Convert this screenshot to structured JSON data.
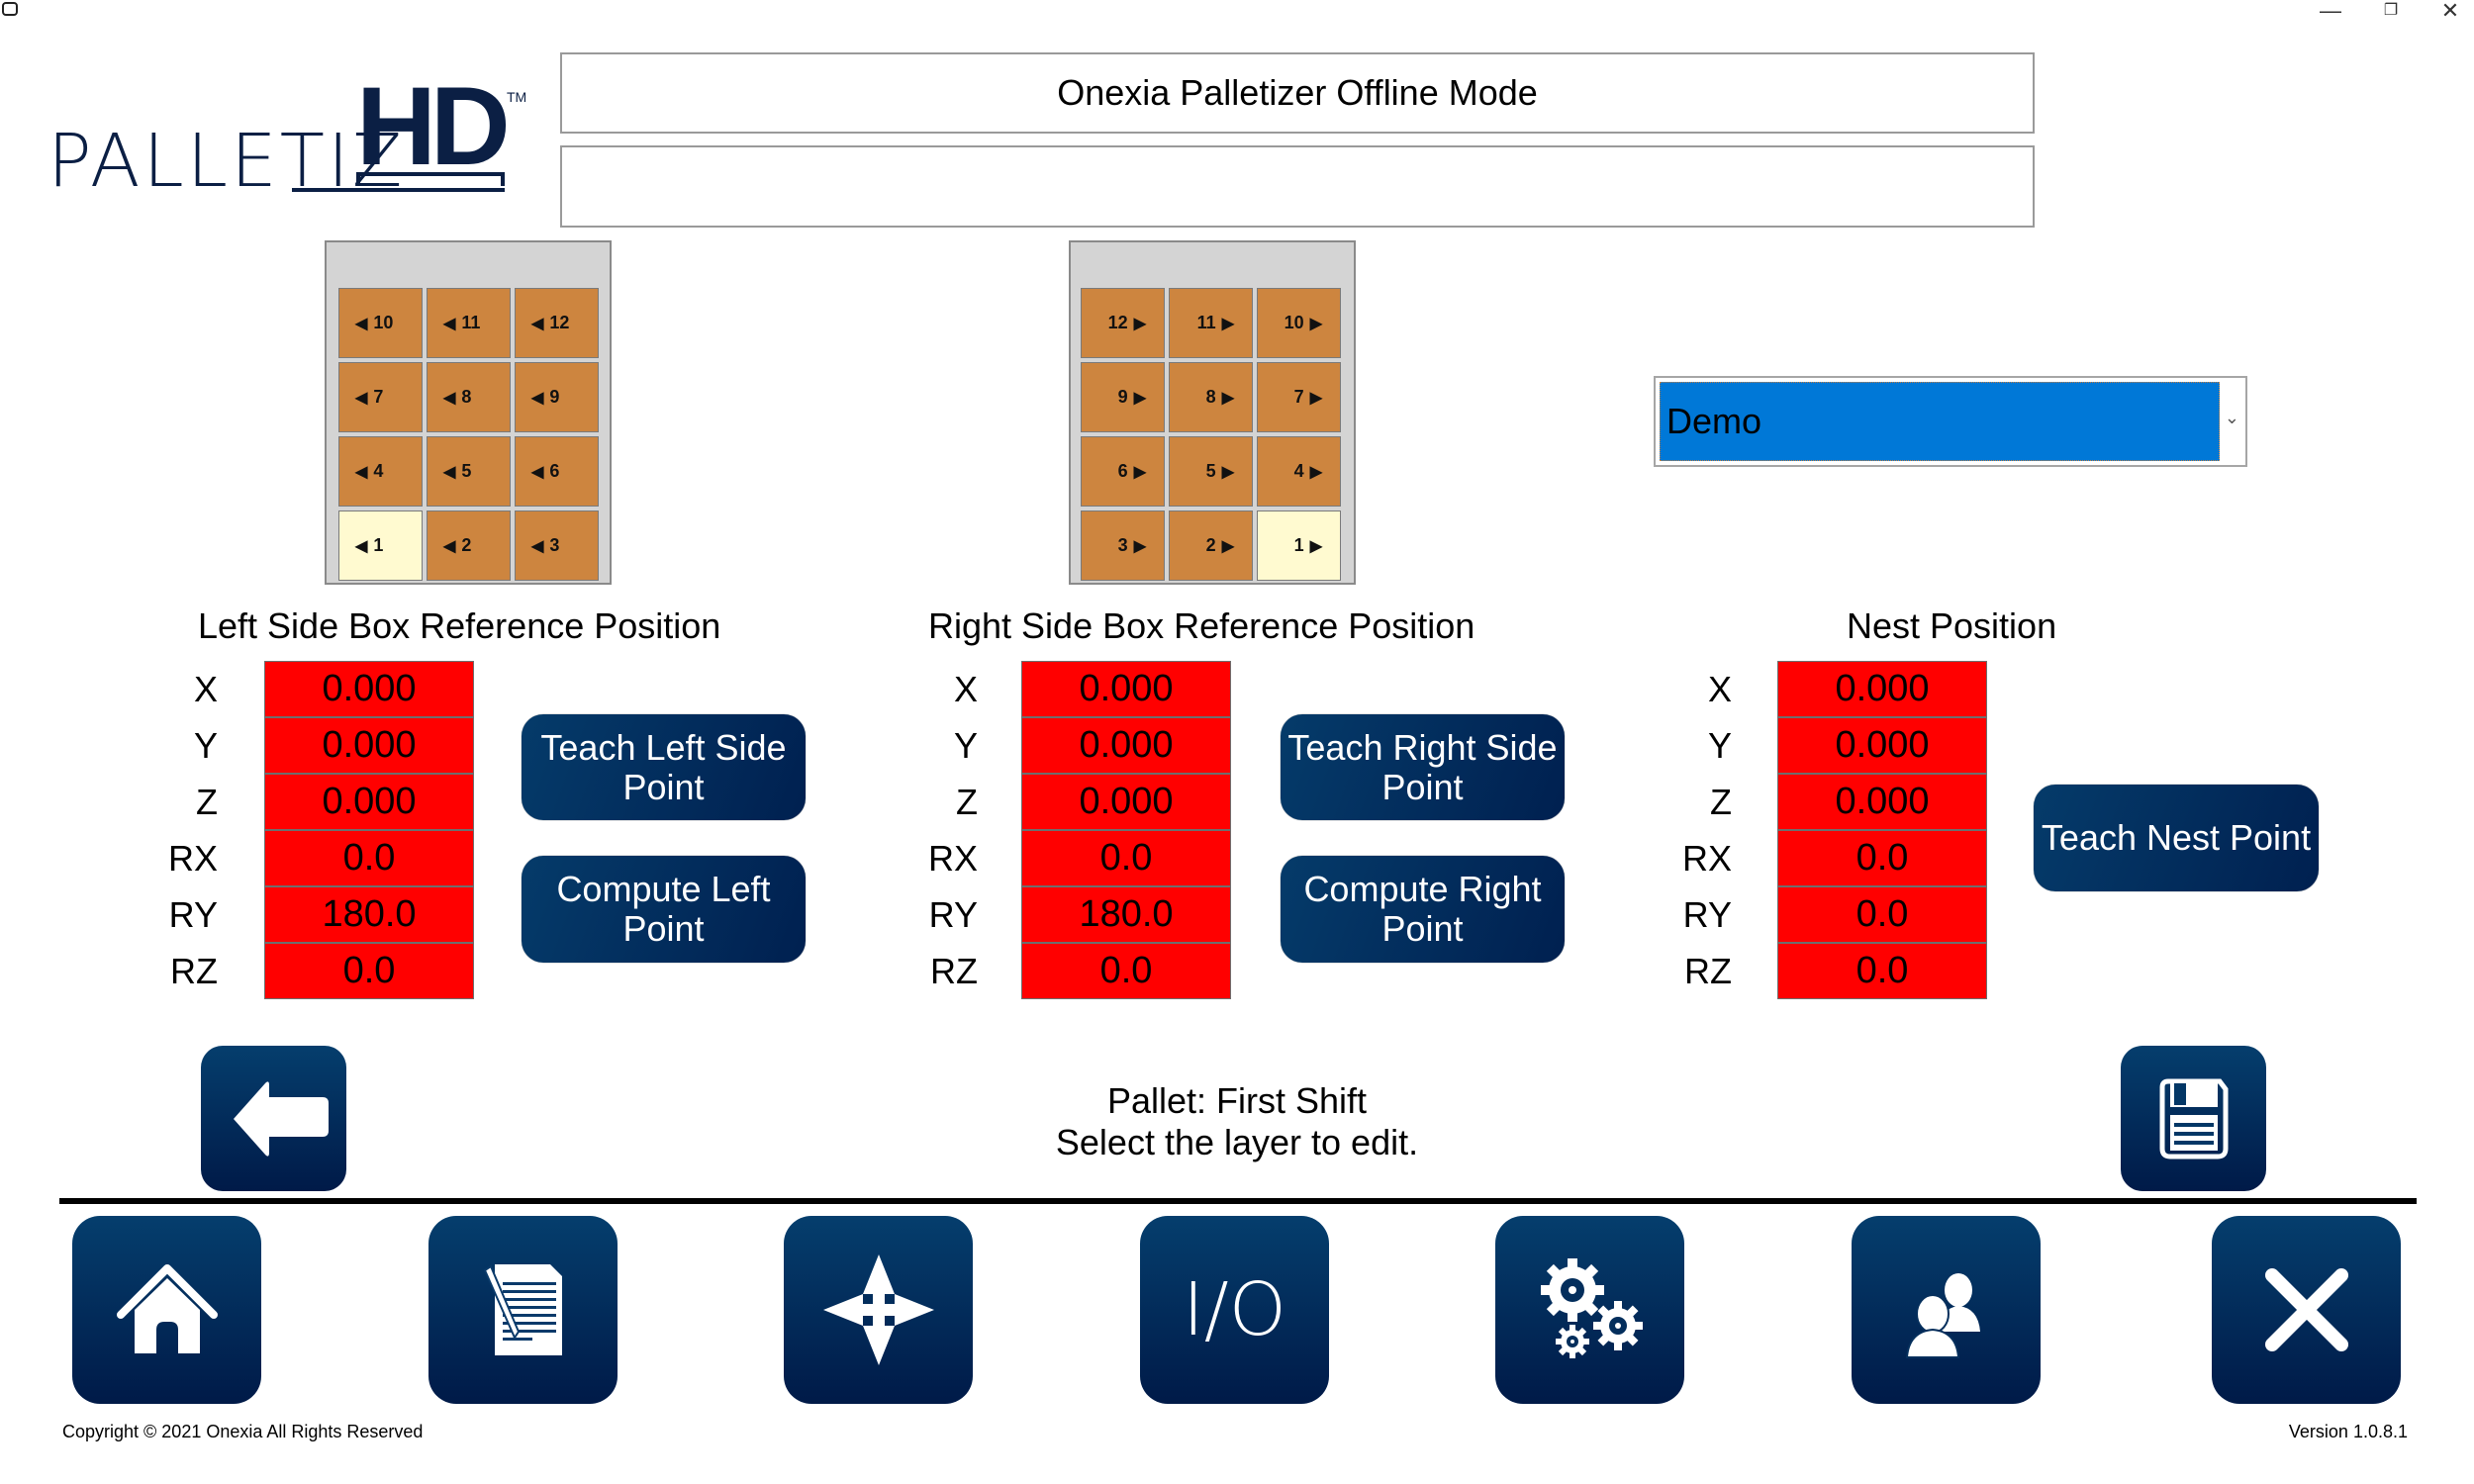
{
  "window": {
    "controls": {
      "minimize": "—",
      "restore": "❐",
      "close": "✕"
    }
  },
  "logo": {
    "text": "PALLETIZ",
    "hd": "HD",
    "tm": "TM"
  },
  "header": {
    "title": "Onexia Palletizer Offline Mode",
    "message": ""
  },
  "left_grid": {
    "rows": [
      [
        {
          "label": "10",
          "arrow": "◀"
        },
        {
          "label": "11",
          "arrow": "◀"
        },
        {
          "label": "12",
          "arrow": "◀"
        }
      ],
      [
        {
          "label": "7",
          "arrow": "◀"
        },
        {
          "label": "8",
          "arrow": "◀"
        },
        {
          "label": "9",
          "arrow": "◀"
        }
      ],
      [
        {
          "label": "4",
          "arrow": "◀"
        },
        {
          "label": "5",
          "arrow": "◀"
        },
        {
          "label": "6",
          "arrow": "◀"
        }
      ],
      [
        {
          "label": "1",
          "arrow": "◀",
          "selected": true
        },
        {
          "label": "2",
          "arrow": "◀"
        },
        {
          "label": "3",
          "arrow": "◀"
        }
      ]
    ]
  },
  "right_grid": {
    "rows": [
      [
        {
          "label": "12",
          "arrow": "▶"
        },
        {
          "label": "11",
          "arrow": "▶"
        },
        {
          "label": "10",
          "arrow": "▶"
        }
      ],
      [
        {
          "label": "9",
          "arrow": "▶"
        },
        {
          "label": "8",
          "arrow": "▶"
        },
        {
          "label": "7",
          "arrow": "▶"
        }
      ],
      [
        {
          "label": "6",
          "arrow": "▶"
        },
        {
          "label": "5",
          "arrow": "▶"
        },
        {
          "label": "4",
          "arrow": "▶"
        }
      ],
      [
        {
          "label": "3",
          "arrow": "▶"
        },
        {
          "label": "2",
          "arrow": "▶"
        },
        {
          "label": "1",
          "arrow": "▶",
          "selected": true
        }
      ]
    ]
  },
  "dropdown": {
    "selected": "Demo",
    "chevron": "⌄"
  },
  "sections": {
    "left": {
      "title": "Left Side Box Reference Position",
      "fields": [
        {
          "label": "X",
          "value": "0.000"
        },
        {
          "label": "Y",
          "value": "0.000"
        },
        {
          "label": "Z",
          "value": "0.000"
        },
        {
          "label": "RX",
          "value": "0.0"
        },
        {
          "label": "RY",
          "value": "180.0"
        },
        {
          "label": "RZ",
          "value": "0.0"
        }
      ],
      "teach_label": "Teach Left Side Point",
      "compute_label": "Compute Left Point"
    },
    "right": {
      "title": "Right Side Box Reference Position",
      "fields": [
        {
          "label": "X",
          "value": "0.000"
        },
        {
          "label": "Y",
          "value": "0.000"
        },
        {
          "label": "Z",
          "value": "0.000"
        },
        {
          "label": "RX",
          "value": "0.0"
        },
        {
          "label": "RY",
          "value": "180.0"
        },
        {
          "label": "RZ",
          "value": "0.0"
        }
      ],
      "teach_label": "Teach Right Side Point",
      "compute_label": "Compute Right Point"
    },
    "nest": {
      "title": "Nest Position",
      "fields": [
        {
          "label": "X",
          "value": "0.000"
        },
        {
          "label": "Y",
          "value": "0.000"
        },
        {
          "label": "Z",
          "value": "0.000"
        },
        {
          "label": "RX",
          "value": "0.0"
        },
        {
          "label": "RY",
          "value": "0.0"
        },
        {
          "label": "RZ",
          "value": "0.0"
        }
      ],
      "teach_label": "Teach Nest Point"
    }
  },
  "status": {
    "line1": "Pallet: First Shift",
    "line2": "Select the layer to edit."
  },
  "nav": {
    "back_icon": "arrow-left",
    "save_icon": "floppy-disk",
    "bottom": [
      {
        "name": "home",
        "icon": "home"
      },
      {
        "name": "recipes",
        "icon": "document-edit"
      },
      {
        "name": "jog",
        "icon": "move-arrows"
      },
      {
        "name": "io",
        "icon": "io",
        "text": "I/O"
      },
      {
        "name": "settings",
        "icon": "gears"
      },
      {
        "name": "users",
        "icon": "users"
      },
      {
        "name": "exit",
        "icon": "close"
      }
    ]
  },
  "colors": {
    "accent": "#002050",
    "field_bg": "#ff0000",
    "cell_bg": "#cd853f",
    "cell_selected": "#fffad0",
    "dropdown_bg": "#0078d7"
  },
  "footer": {
    "copyright": "Copyright © 2021 Onexia All Rights Reserved",
    "version": "Version 1.0.8.1"
  }
}
